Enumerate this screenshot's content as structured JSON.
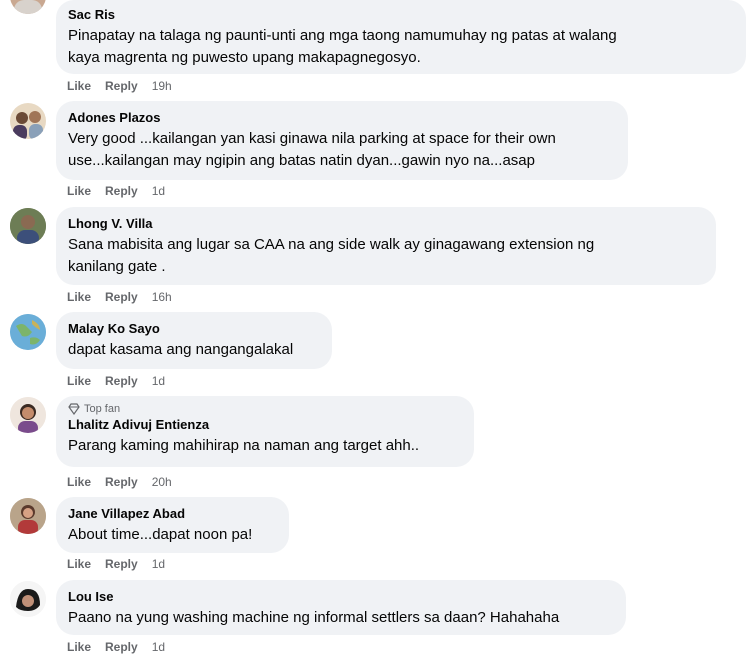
{
  "labels": {
    "like": "Like",
    "reply": "Reply",
    "top_fan": "Top fan"
  },
  "comments": [
    {
      "name": "Sac Ris",
      "text1": "Pinapatay na talaga ng paunti-unti ang mga taong namumuhay ng patas at walang",
      "text2": "kaya magrenta ng puwesto upang makapagnegosyo.",
      "time": "19h"
    },
    {
      "name": "Adones Plazos",
      "text1": "Very good ...kailangan yan kasi ginawa nila parking at space for their own",
      "text2": "use...kailangan may ngipin ang batas natin dyan...gawin nyo na...asap",
      "time": "1d"
    },
    {
      "name": "Lhong V. Villa",
      "text1": "Sana mabisita ang lugar sa CAA na ang side walk ay ginagawang extension ng",
      "text2": "kanilang gate .",
      "time": "16h"
    },
    {
      "name": "Malay Ko Sayo",
      "text1": "dapat kasama ang nangangalakal",
      "time": "1d"
    },
    {
      "name": "Lhalitz Adivuj Entienza",
      "text1": "Parang kaming mahihirap na naman ang target ahh..",
      "time": "20h"
    },
    {
      "name": "Jane Villapez Abad",
      "text1": "About time...dapat noon pa!",
      "time": "1d"
    },
    {
      "name": "Lou Ise",
      "text1": "Paano na yung washing machine ng informal settlers sa daan? Hahahaha",
      "time": "1d"
    }
  ]
}
